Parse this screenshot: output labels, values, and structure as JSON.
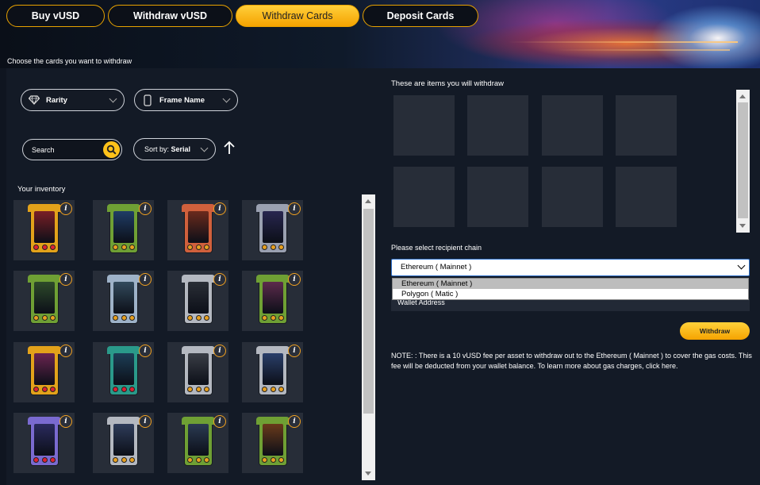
{
  "tabs": [
    {
      "label": "Buy vUSD"
    },
    {
      "label": "Withdraw vUSD"
    },
    {
      "label": "Withdraw Cards"
    },
    {
      "label": "Deposit Cards"
    }
  ],
  "subtitle": "Choose the cards you want to withdraw",
  "filters": {
    "rarity_label": "Rarity",
    "frame_label": "Frame Name",
    "search_value": "Search",
    "sort_prefix": "Sort by:",
    "sort_value": "Serial"
  },
  "inventory": {
    "label": "Your inventory",
    "info_glyph": "i",
    "cards": [
      {
        "frame": "#e3a21a",
        "art": "#7a1f26",
        "gems": "#d23"
      },
      {
        "frame": "#6fa034",
        "art": "#1f3d66",
        "gems": "#e8a020"
      },
      {
        "frame": "#d0603c",
        "art": "#6b2a1c",
        "gems": "#e8a020"
      },
      {
        "frame": "#9aa0b0",
        "art": "#28264f",
        "gems": "#e8a020"
      },
      {
        "frame": "#6fa034",
        "art": "#2d4a2a",
        "gems": "#e8a020"
      },
      {
        "frame": "#9eb2c8",
        "art": "#324a5c",
        "gems": "#e8a020"
      },
      {
        "frame": "#b4b8c0",
        "art": "#2a2e36",
        "gems": "#e8a020"
      },
      {
        "frame": "#6fa034",
        "art": "#5c2a4c",
        "gems": "#e8a020"
      },
      {
        "frame": "#e3a21a",
        "art": "#6a2450",
        "gems": "#d23"
      },
      {
        "frame": "#2a9a8a",
        "art": "#1c3e56",
        "gems": "#d23"
      },
      {
        "frame": "#b4b8c0",
        "art": "#3a3e46",
        "gems": "#e8a020"
      },
      {
        "frame": "#b4b8c0",
        "art": "#2a3f6a",
        "gems": "#e8a020"
      },
      {
        "frame": "#7a6ad0",
        "art": "#2a2a5e",
        "gems": "#d23"
      },
      {
        "frame": "#b4b8c0",
        "art": "#2e3c5a",
        "gems": "#e8a020"
      },
      {
        "frame": "#6fa034",
        "art": "#2a3a52",
        "gems": "#e8a020"
      },
      {
        "frame": "#6fa034",
        "art": "#6a3a1a",
        "gems": "#e8a020"
      }
    ]
  },
  "withdraw_panel": {
    "title": "These are items you will withdraw",
    "chain_label": "Please select recipient chain",
    "selected_chain": "Ethereum ( Mainnet )",
    "chain_options": [
      "Ethereum ( Mainnet )",
      "Polygon ( Matic )"
    ],
    "wallet_label": "Wallet Address",
    "withdraw_button": "Withdraw",
    "note": "NOTE: : There is a 10 vUSD fee per asset to withdraw out to the Ethereum ( Mainnet ) to cover the gas costs. This fee will be deducted from your wallet balance. To learn more about gas charges, click here."
  },
  "colors": {
    "accent": "#f5a300",
    "panel": "#131a26",
    "slot": "#272d38"
  }
}
